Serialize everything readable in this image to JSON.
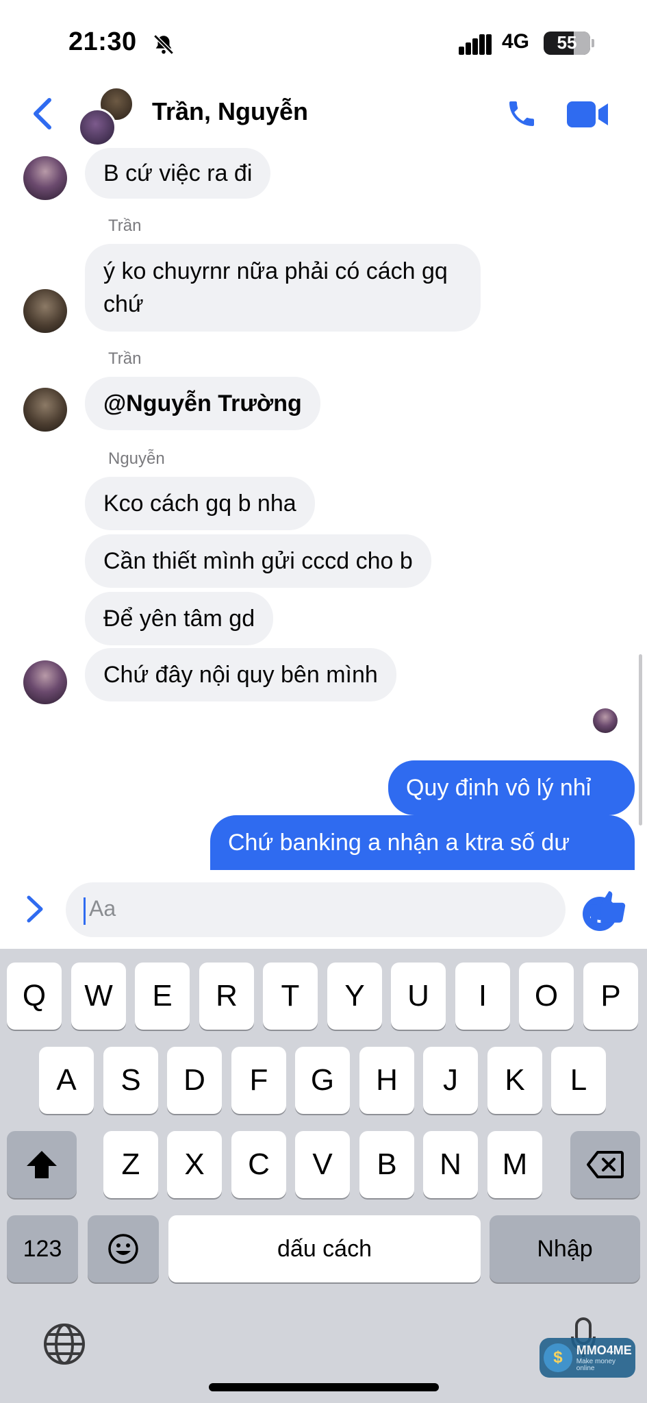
{
  "status_bar": {
    "time": "21:30",
    "network": "4G",
    "battery": "55"
  },
  "header": {
    "title": "Trần, Nguyễn"
  },
  "messages": [
    {
      "text": "B cứ việc ra đi"
    },
    {
      "sender": "Trần",
      "text": "ý ko chuyrnr nữa phải có cách gq chứ"
    },
    {
      "sender": "Trần",
      "text": "@Nguyễn Trường"
    },
    {
      "sender": "Nguyễn",
      "text": "Kco cách gq b nha"
    },
    {
      "text": "Cần thiết mình gửi cccd cho b"
    },
    {
      "text": "Để yên tâm gd"
    },
    {
      "text": "Chứ đây nội quy bên mình"
    }
  ],
  "outgoing": [
    {
      "text": "Quy định vô lý nhỉ"
    },
    {
      "text": "Chứ banking a nhận a ktra số dư"
    }
  ],
  "composer": {
    "placeholder": "Aa"
  },
  "keyboard": {
    "row1": [
      "Q",
      "W",
      "E",
      "R",
      "T",
      "Y",
      "U",
      "I",
      "O",
      "P"
    ],
    "row2": [
      "A",
      "S",
      "D",
      "F",
      "G",
      "H",
      "J",
      "K",
      "L"
    ],
    "row3": [
      "Z",
      "X",
      "C",
      "V",
      "B",
      "N",
      "M"
    ],
    "numbers_key": "123",
    "space_key": "dấu cách",
    "return_key": "Nhập"
  },
  "watermark": {
    "logo": "$",
    "title": "MMO4ME",
    "subtitle": "Make money online"
  },
  "colors": {
    "accent": "#2f6bf0",
    "incoming_bubble": "#f0f1f4",
    "keyboard_bg": "#d2d4da"
  }
}
